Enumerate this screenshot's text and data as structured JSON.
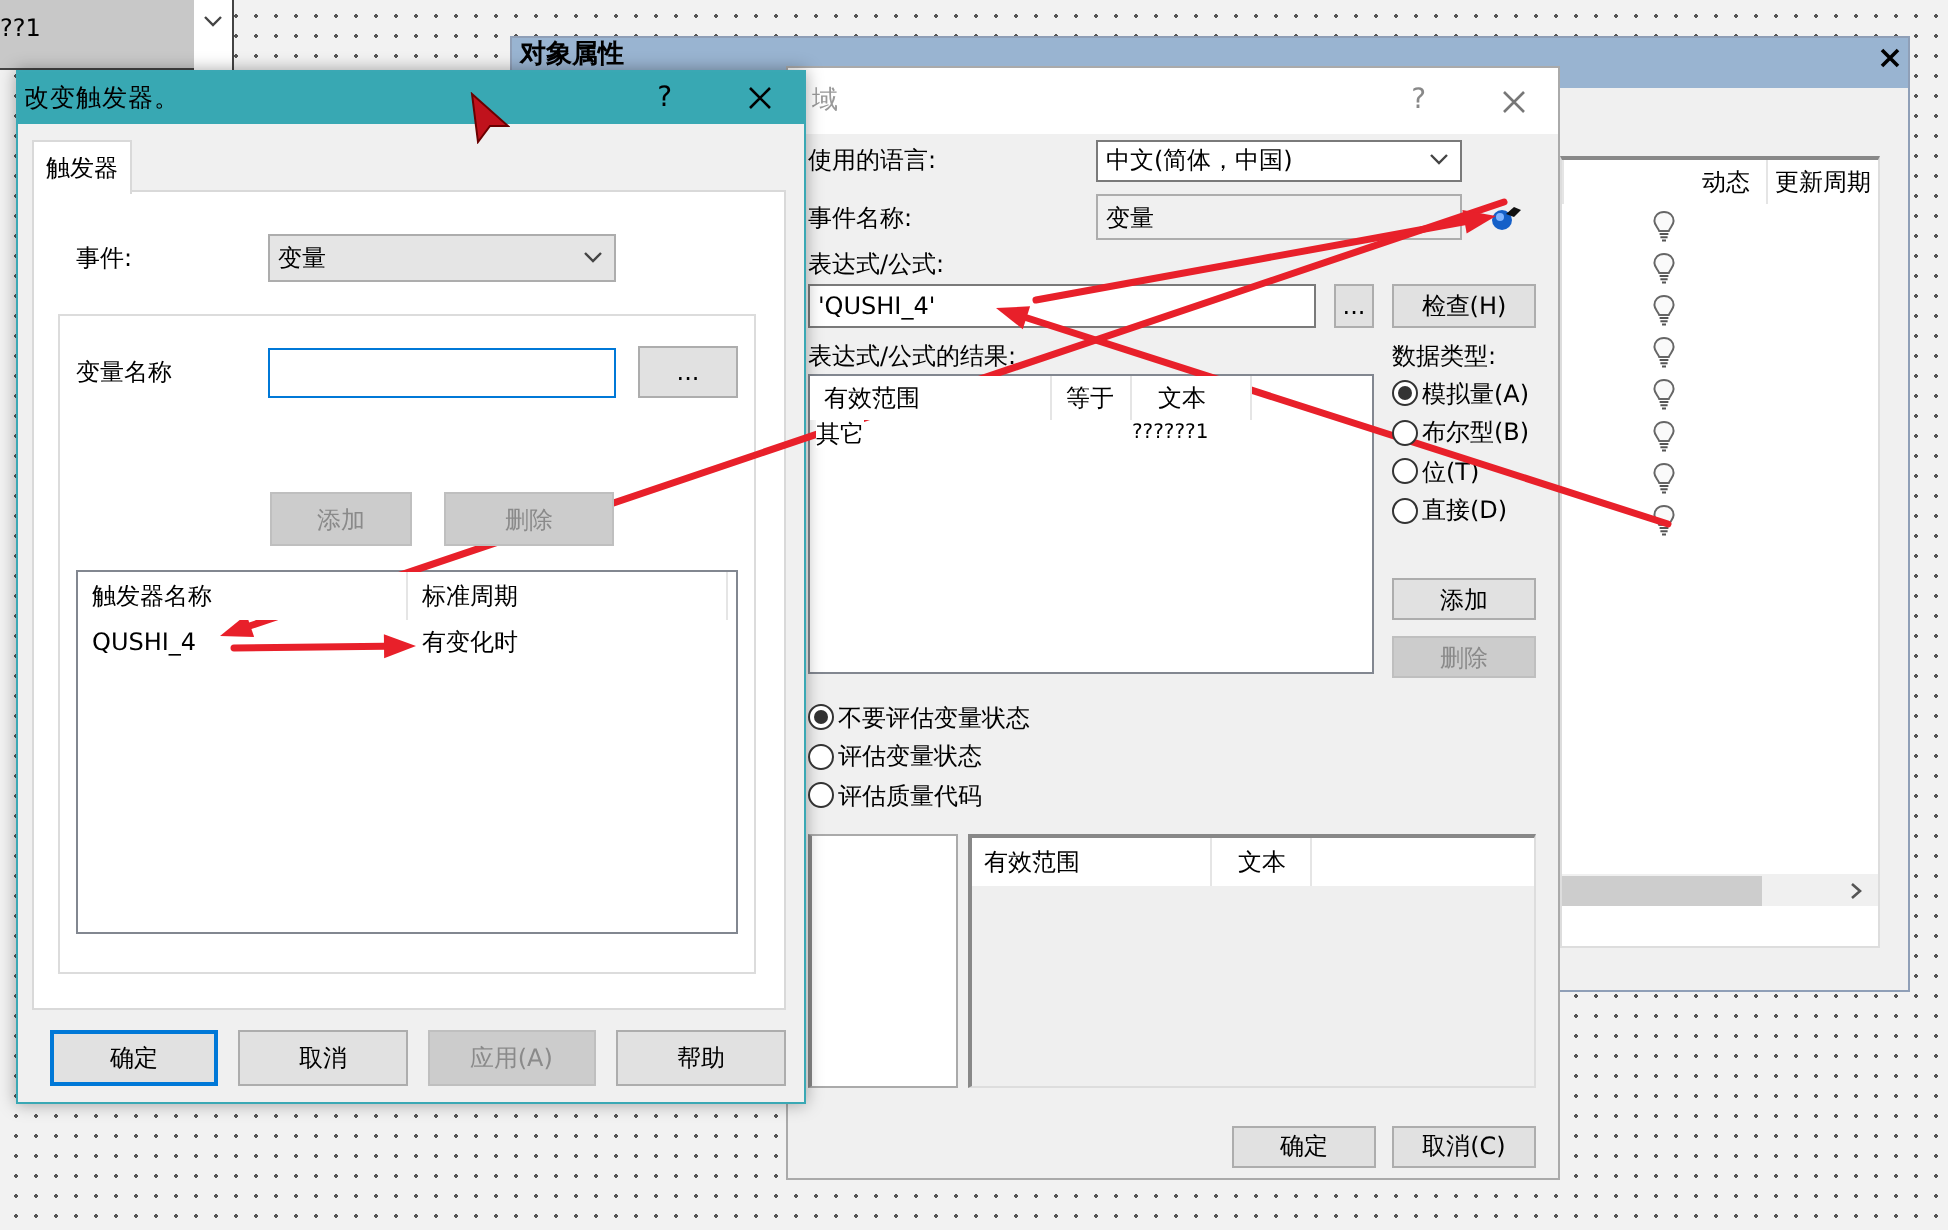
{
  "background": {
    "combo_text": "??1"
  },
  "object_properties": {
    "title": "对象属性",
    "columns": [
      "动态",
      "更新周期"
    ]
  },
  "value_dialog": {
    "title": "域",
    "help": "?",
    "language_label": "使用的语言:",
    "language_value": "中文(简体，中国)",
    "event_label": "事件名称:",
    "event_value": "变量",
    "expression_label": "表达式/公式:",
    "expression_value": "'QUSHI_4'",
    "browse": "...",
    "check_button": "检查(H)",
    "result_label": "表达式/公式的结果:",
    "result_columns": [
      "有效范围",
      "等于",
      "文本"
    ],
    "result_rows": [
      {
        "range": "其它",
        "text": "??????1"
      }
    ],
    "data_type_label": "数据类型:",
    "data_types": [
      {
        "label": "模拟量(A)",
        "selected": true
      },
      {
        "label": "布尔型(B)",
        "selected": false
      },
      {
        "label": "位(T)",
        "selected": false
      },
      {
        "label": "直接(D)",
        "selected": false
      }
    ],
    "side_buttons": [
      {
        "label": "添加",
        "disabled": false
      },
      {
        "label": "删除",
        "disabled": true
      }
    ],
    "eval_options": [
      {
        "label": "不要评估变量状态",
        "selected": true
      },
      {
        "label": "评估变量状态",
        "selected": false
      },
      {
        "label": "评估质量代码",
        "selected": false
      }
    ],
    "lower_columns": [
      "有效范围",
      "文本"
    ],
    "buttons": [
      {
        "label": "确定",
        "disabled": false
      },
      {
        "label": "取消(C)",
        "disabled": false
      }
    ]
  },
  "trigger_dialog": {
    "title": "改变触发器。",
    "help": "?",
    "tabs": [
      {
        "label": "触发器",
        "selected": true
      }
    ],
    "event_label": "事件:",
    "event_value": "变量",
    "variable_label": "变量名称",
    "variable_placeholder_browse": "...",
    "list_buttons": [
      {
        "label": "添加",
        "disabled": true
      },
      {
        "label": "删除",
        "disabled": true
      }
    ],
    "columns": [
      "触发器名称",
      "标准周期"
    ],
    "rows": [
      [
        "QUSHI_4",
        "有变化时"
      ]
    ],
    "buttons": [
      {
        "label": "确定",
        "disabled": false,
        "default": true
      },
      {
        "label": "取消",
        "disabled": false,
        "default": false
      },
      {
        "label": "应用(A)",
        "disabled": true,
        "default": false
      },
      {
        "label": "帮助",
        "disabled": false,
        "default": false
      }
    ]
  }
}
